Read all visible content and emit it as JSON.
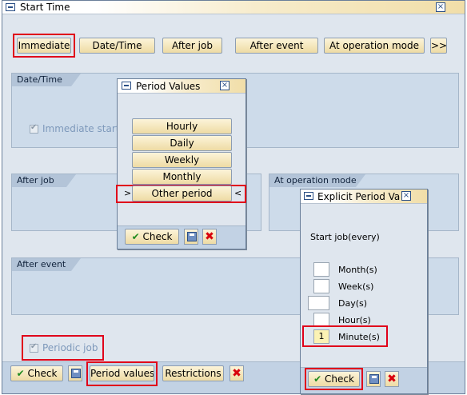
{
  "main": {
    "title": "Start Time",
    "close": "×",
    "buttons": {
      "immediate": "Immediate",
      "datetime": "Date/Time",
      "after_job": "After job",
      "after_event": "After event",
      "at_operation_mode": "At operation mode",
      "more": ">>"
    },
    "groups": {
      "datetime": "Date/Time",
      "after_job": "After job",
      "at_operation_mode": "At operation mode",
      "after_event": "After event"
    },
    "immediate_start_label": "Immediate start",
    "periodic_job_label": "Periodic job",
    "toolbar": {
      "check": "Check",
      "period_values": "Period values",
      "restrictions": "Restrictions"
    }
  },
  "period_popup": {
    "title": "Period Values",
    "close": "×",
    "options": [
      "Hourly",
      "Daily",
      "Weekly",
      "Monthly"
    ],
    "other_period": "Other period",
    "arrow_left": ">",
    "arrow_right": "<",
    "check": "Check"
  },
  "explicit_popup": {
    "title": "Explicit Period Va",
    "close": "×",
    "start_label": "Start job(every)",
    "rows": [
      {
        "label": "Month(s)",
        "value": ""
      },
      {
        "label": "Week(s)",
        "value": ""
      },
      {
        "label": "Day(s)",
        "value": ""
      },
      {
        "label": "Hour(s)",
        "value": ""
      },
      {
        "label": "Minute(s)",
        "value": "1"
      }
    ],
    "check": "Check"
  },
  "colors": {
    "highlight": "#e0001a",
    "group_fill": "#cddbea",
    "button_gradient_top": "#fcf4d9"
  }
}
